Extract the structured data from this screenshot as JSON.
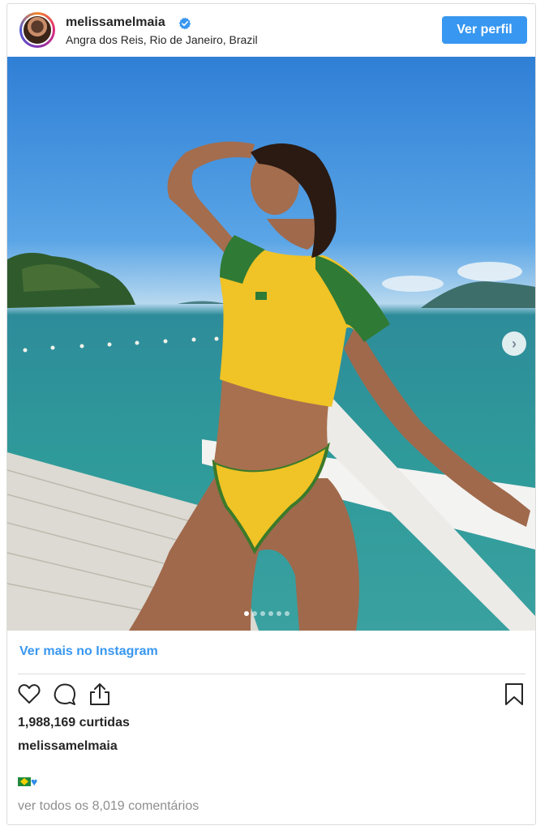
{
  "header": {
    "username": "melissamelmaia",
    "location": "Angra dos Reis, Rio de Janeiro, Brazil",
    "profile_button": "Ver perfil"
  },
  "photo": {
    "carousel_total": 6,
    "carousel_active": 1
  },
  "footer": {
    "more_link": "Ver mais no Instagram",
    "likes": "1,988,169 curtidas",
    "caption_user": "melissamelmaia",
    "view_comments": "ver todos os 8,019 comentários"
  },
  "icons": {
    "like": "heart-icon",
    "comment": "comment-icon",
    "share": "share-icon",
    "save": "bookmark-icon",
    "verified": "verified-badge-icon",
    "next": "chevron-right-icon"
  },
  "colors": {
    "accent": "#3897f0",
    "border": "#dbdbdb",
    "text": "#262626",
    "muted": "#8e8e8e"
  }
}
